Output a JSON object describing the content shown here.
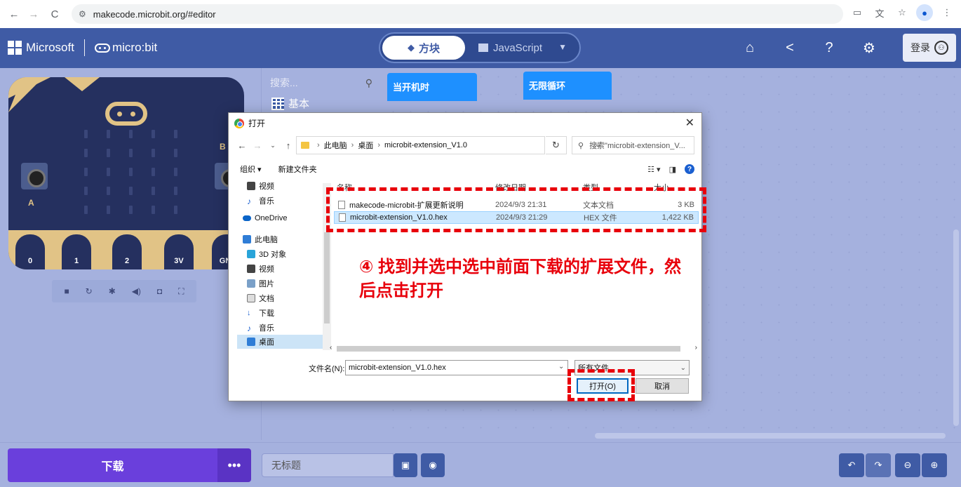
{
  "browser": {
    "url": "makecode.microbit.org/#editor"
  },
  "header": {
    "brand": "Microsoft",
    "product": "micro:bit",
    "tab_blocks": "方块",
    "tab_js": "JavaScript",
    "login": "登录"
  },
  "simulator": {
    "label_a": "A",
    "label_b": "B",
    "pins": [
      "0",
      "1",
      "2",
      "3V",
      "GND"
    ]
  },
  "toolbox": {
    "search_placeholder": "搜索...",
    "category_basic": "基本"
  },
  "canvas": {
    "block_on_start": "当开机时",
    "block_forever": "无限循环"
  },
  "bottom": {
    "download": "下载",
    "more": "•••",
    "project_name": "无标题"
  },
  "dialog": {
    "title": "打开",
    "breadcrumb": [
      "此电脑",
      "桌面",
      "microbit-extension_V1.0"
    ],
    "search_placeholder": "搜索\"microbit-extension_V...",
    "organize": "组织 ▾",
    "new_folder": "新建文件夹",
    "nav_items": [
      "视频",
      "音乐",
      "OneDrive",
      "此电脑",
      "3D 对象",
      "视频",
      "图片",
      "文档",
      "下载",
      "音乐",
      "桌面"
    ],
    "columns": [
      "名称",
      "修改日期",
      "类型",
      "大小"
    ],
    "files": [
      {
        "name": "makecode-microbit-扩展更新说明",
        "date": "2024/9/3 21:31",
        "type": "文本文档",
        "size": "3 KB"
      },
      {
        "name": "microbit-extension_V1.0.hex",
        "date": "2024/9/3 21:29",
        "type": "HEX 文件",
        "size": "1,422 KB"
      }
    ],
    "filename_label": "文件名(N):",
    "filename_value": "microbit-extension_V1.0.hex",
    "filetype": "所有文件",
    "open_button": "打开(O)",
    "cancel_button": "取消"
  },
  "annotation": {
    "text": "④ 找到并选中选中前面下载的扩展文件，然后点击打开",
    "color": "#e8000b"
  }
}
